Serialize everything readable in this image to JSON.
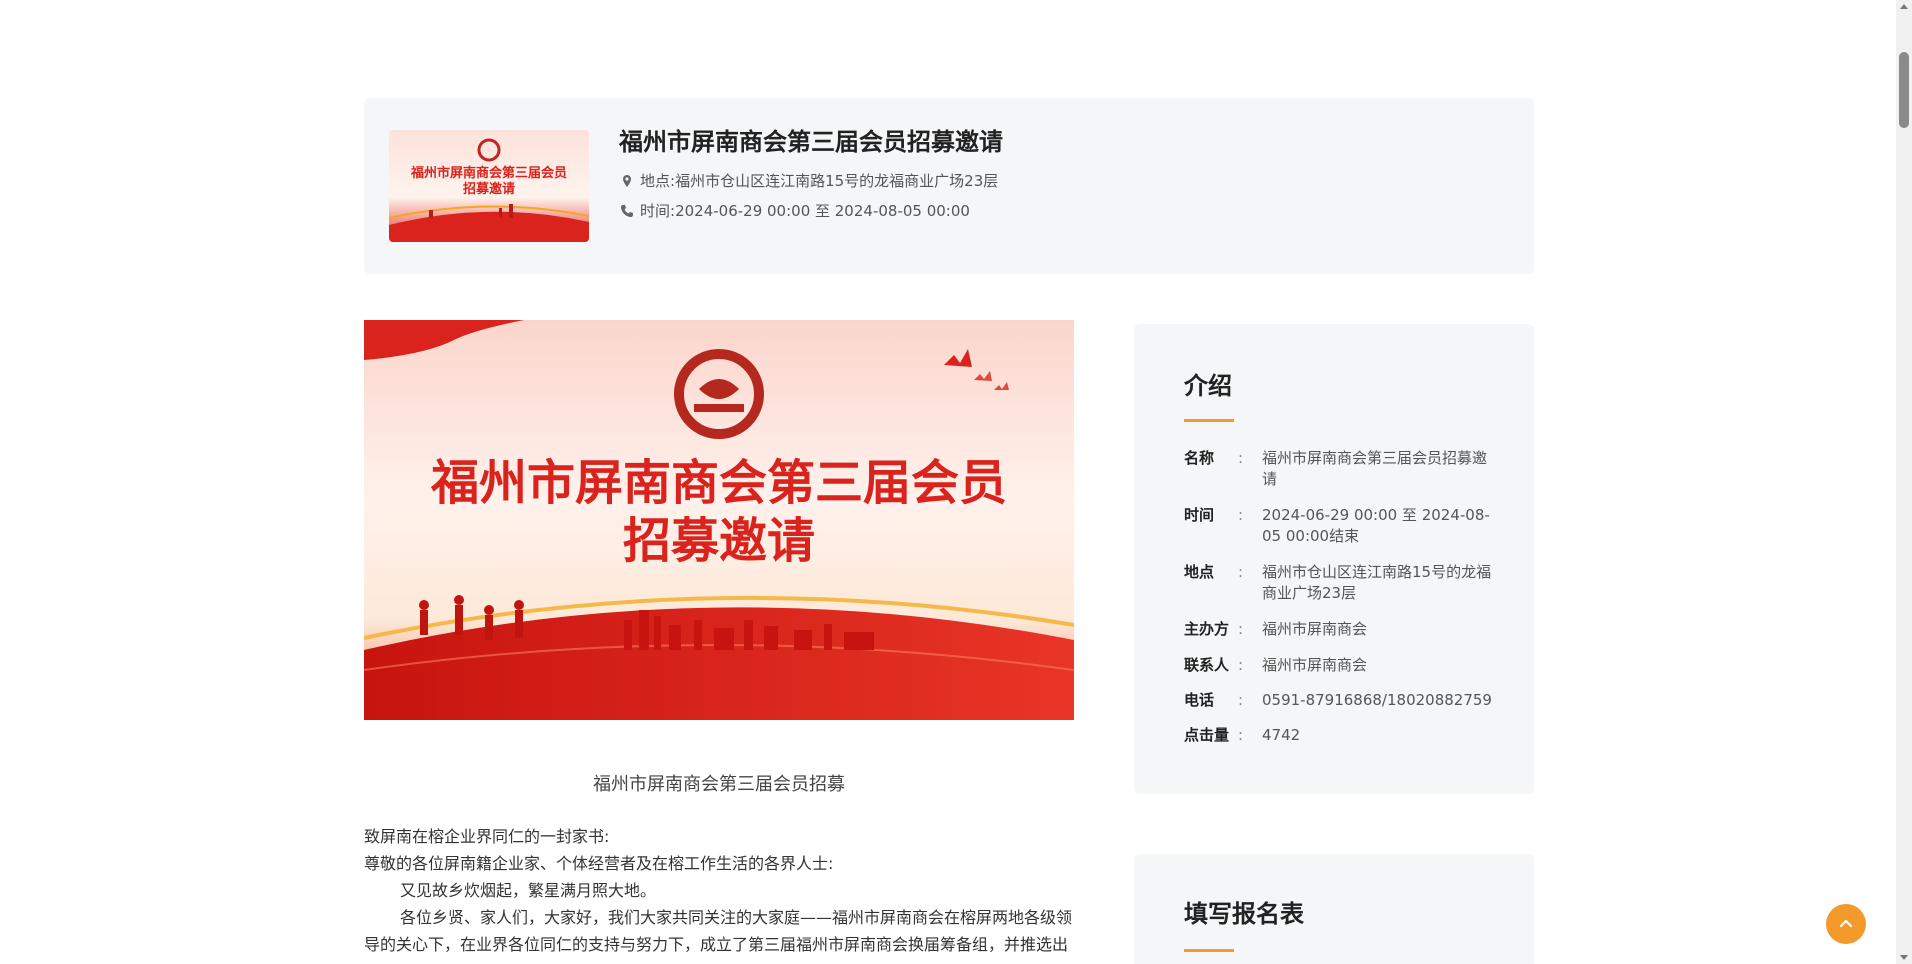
{
  "event": {
    "title": "福州市屏南商会第三届会员招募邀请",
    "address_label": "地点:",
    "address": "福州市仓山区连江南路15号的龙福商业广场23层",
    "time_label": "时间:",
    "time": "2024-06-29 00:00 至 2024-08-05 00:00",
    "thumb_text_line1": "福州市屏南商会第三届会员",
    "thumb_text_line2": "招募邀请"
  },
  "banner": {
    "line1": "福州市屏南商会第三届会员",
    "line2": "招募邀请"
  },
  "article": {
    "caption": "福州市屏南商会第三届会员招募",
    "p1": "致屏南在榕企业界同仁的一封家书:",
    "p2": "尊敬的各位屏南籍企业家、个体经营者及在榕工作生活的各界人士:",
    "p3": "又见故乡炊烟起，繁星满月照大地。",
    "p4": "各位乡贤、家人们，大家好，我们大家共同关注的大家庭——福州市屏南商会在榕屏两地各级领导的关心下，在业界各位同仁的支持与努力下，成立了第三届福州市屏南商会换届筹备组，并推选出"
  },
  "intro": {
    "title": "介绍",
    "rows": [
      {
        "k": "名称",
        "v": "福州市屏南商会第三届会员招募邀请"
      },
      {
        "k": "时间",
        "v": "2024-06-29 00:00 至 2024-08-05 00:00结束"
      },
      {
        "k": "地点",
        "v": "福州市仓山区连江南路15号的龙福商业广场23层"
      },
      {
        "k": "主办方",
        "v": "福州市屏南商会"
      },
      {
        "k": "联系人",
        "v": "福州市屏南商会"
      },
      {
        "k": "电话",
        "v": "0591-87916868/18020882759"
      },
      {
        "k": "点击量",
        "v": "4742"
      }
    ],
    "colon": ":"
  },
  "signup": {
    "title": "填写报名表"
  },
  "colors": {
    "accent": "#f39a2b",
    "banner_red": "#d9231c",
    "card_bg": "#f4f6f7"
  },
  "icons": [
    "location-icon",
    "phone-icon",
    "logo-icon",
    "arrow-up-icon"
  ]
}
